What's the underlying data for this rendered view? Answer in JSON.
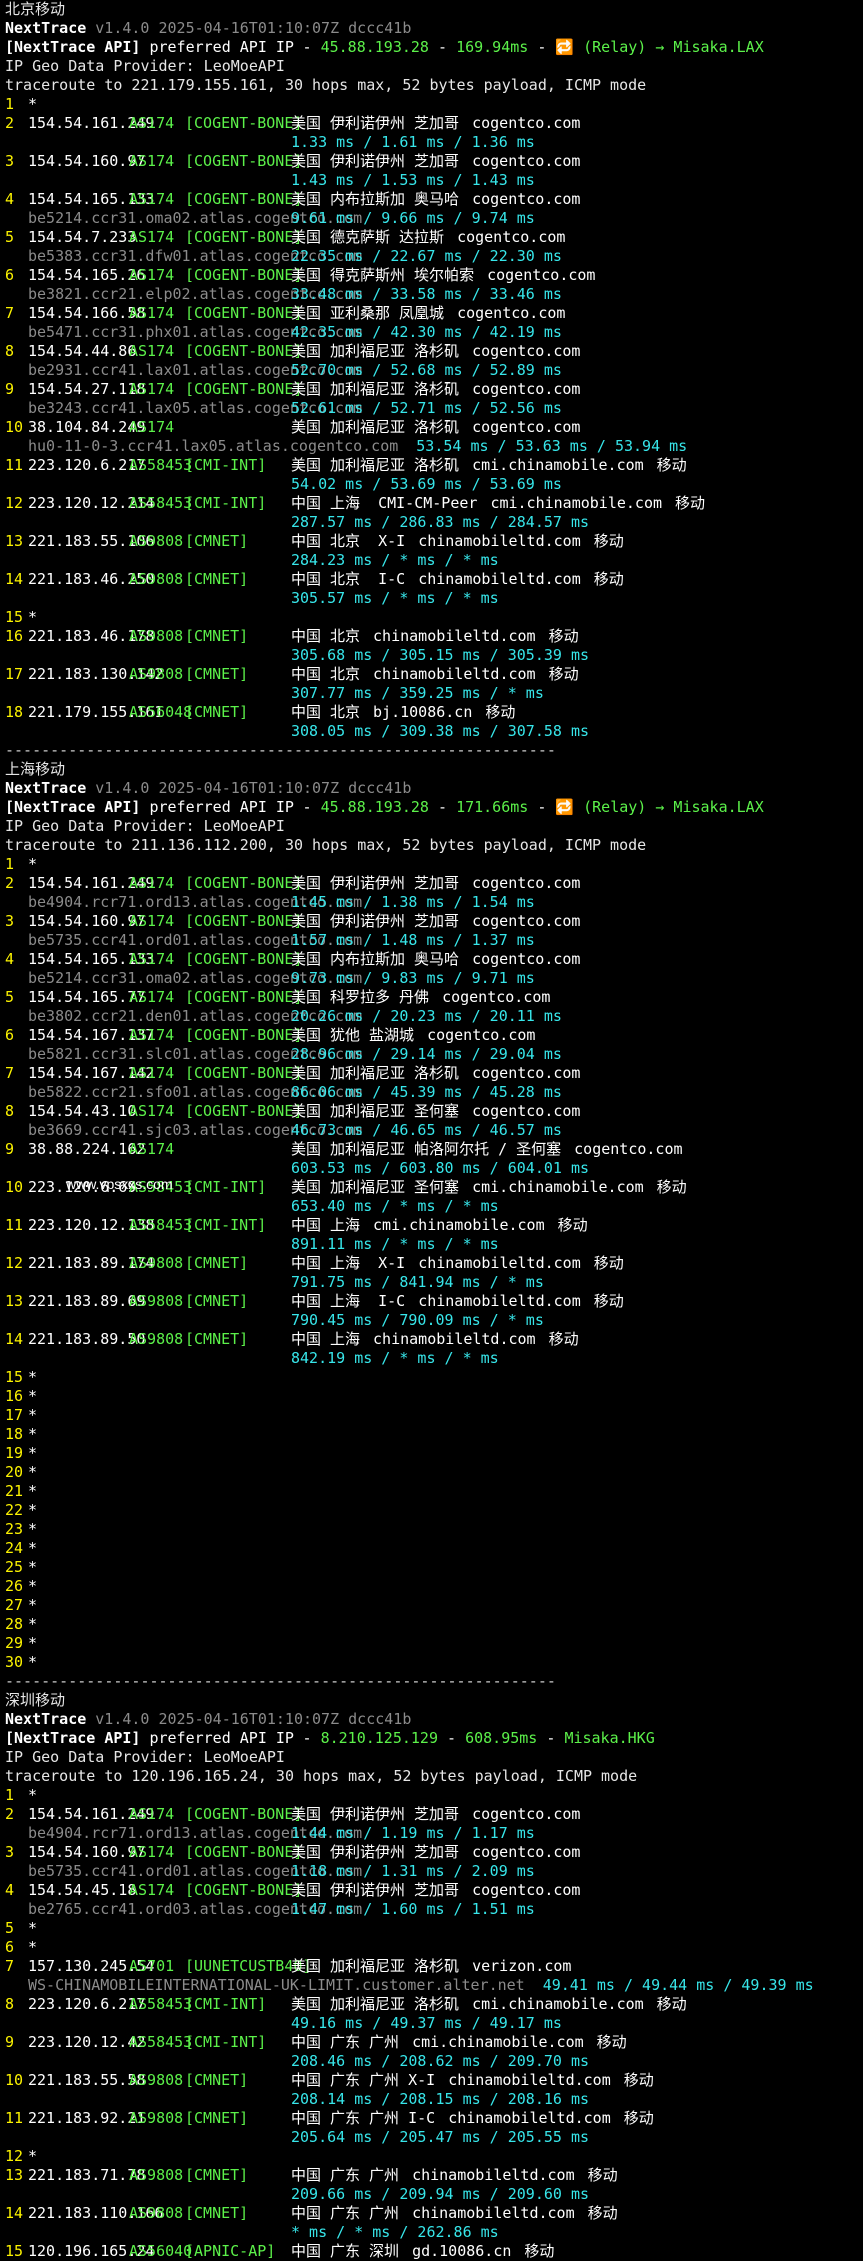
{
  "watermark": "www.vpsxxs.com",
  "separator": "-------------------------------------------------------------",
  "sections": [
    {
      "title": "北京移动",
      "nt_name": "NextTrace",
      "nt_version": "v1.4.0 2025-04-16T01:10:07Z dccc41b",
      "api_prefix": "[NextTrace API]",
      "api_text": "preferred API IP",
      "api_ip": "45.88.193.28",
      "api_ms": "169.94ms",
      "api_relay": "🔁 (Relay) → Misaka.LAX",
      "geo_provider": "IP Geo Data Provider: LeoMoeAPI",
      "traceroute": "traceroute to 221.179.155.161, 30 hops max, 52 bytes payload, ICMP mode",
      "hops": [
        {
          "n": "1",
          "star": true
        },
        {
          "n": "2",
          "ip": "154.54.161.249",
          "as": "AS174",
          "tag": "[COGENT-BONE]",
          "geo": "美国 伊利诺伊州 芝加哥",
          "dom": "cogentco.com",
          "isp": "",
          "host": "",
          "rtt": "1.33 ms / 1.61 ms / 1.36 ms"
        },
        {
          "n": "3",
          "ip": "154.54.160.97",
          "as": "AS174",
          "tag": "[COGENT-BONE]",
          "geo": "美国 伊利诺伊州 芝加哥",
          "dom": "cogentco.com",
          "isp": "",
          "host": "",
          "rtt": "1.43 ms / 1.53 ms / 1.43 ms"
        },
        {
          "n": "4",
          "ip": "154.54.165.133",
          "as": "AS174",
          "tag": "[COGENT-BONE]",
          "geo": "美国 内布拉斯加 奥马哈",
          "dom": "cogentco.com",
          "isp": "",
          "host": "be5214.ccr31.oma02.atlas.cogentco.com",
          "rtt": "9.61 ms / 9.66 ms / 9.74 ms"
        },
        {
          "n": "5",
          "ip": "154.54.7.233",
          "as": "AS174",
          "tag": "[COGENT-BONE]",
          "geo": "美国 德克萨斯 达拉斯",
          "dom": "cogentco.com",
          "isp": "",
          "host": "be5383.ccr31.dfw01.atlas.cogentco.com",
          "rtt": "22.35 ms / 22.67 ms / 22.30 ms"
        },
        {
          "n": "6",
          "ip": "154.54.165.26",
          "as": "AS174",
          "tag": "[COGENT-BONE]",
          "geo": "美国 得克萨斯州 埃尔帕索",
          "dom": "cogentco.com",
          "isp": "",
          "host": "be3821.ccr21.elp02.atlas.cogentco.com",
          "rtt": "33.48 ms / 33.58 ms / 33.46 ms"
        },
        {
          "n": "7",
          "ip": "154.54.166.58",
          "as": "AS174",
          "tag": "[COGENT-BONE]",
          "geo": "美国 亚利桑那 凤凰城",
          "dom": "cogentco.com",
          "isp": "",
          "host": "be5471.ccr31.phx01.atlas.cogentco.com",
          "rtt": "42.35 ms / 42.30 ms / 42.19 ms"
        },
        {
          "n": "8",
          "ip": "154.54.44.86",
          "as": "AS174",
          "tag": "[COGENT-BONE]",
          "geo": "美国 加利福尼亚 洛杉矶",
          "dom": "cogentco.com",
          "isp": "",
          "host": "be2931.ccr41.lax01.atlas.cogentco.com",
          "rtt": "52.70 ms / 52.68 ms / 52.89 ms"
        },
        {
          "n": "9",
          "ip": "154.54.27.118",
          "as": "AS174",
          "tag": "[COGENT-BONE]",
          "geo": "美国 加利福尼亚 洛杉矶",
          "dom": "cogentco.com",
          "isp": "",
          "host": "be3243.ccr41.lax05.atlas.cogentco.com",
          "rtt": "52.61 ms / 52.71 ms / 52.56 ms"
        },
        {
          "n": "10",
          "ip": "38.104.84.249",
          "as": "AS174",
          "tag": "",
          "geo": "美国 加利福尼亚 洛杉矶",
          "dom": "cogentco.com",
          "isp": "",
          "host": "hu0-11-0-3.ccr41.lax05.atlas.cogentco.com",
          "rtt": "53.54 ms / 53.63 ms / 53.94 ms",
          "rtt_inline": true
        },
        {
          "n": "11",
          "ip": "223.120.6.217",
          "as": "AS58453",
          "tag": "[CMI-INT]",
          "geo": "美国 加利福尼亚 洛杉矶",
          "dom": "cmi.chinamobile.com",
          "isp": "移动",
          "host": "",
          "rtt": "54.02 ms / 53.69 ms / 53.69 ms"
        },
        {
          "n": "12",
          "ip": "223.120.12.214",
          "as": "AS58453",
          "tag": "[CMI-INT]",
          "geo": "中国 上海  CMI-CM-Peer",
          "dom": "cmi.chinamobile.com",
          "isp": "移动",
          "host": "",
          "rtt": "287.57 ms / 286.83 ms / 284.57 ms"
        },
        {
          "n": "13",
          "ip": "221.183.55.106",
          "as": "AS9808",
          "tag": "[CMNET]",
          "geo": "中国 北京  X-I",
          "dom": "chinamobileltd.com",
          "isp": "移动",
          "host": "",
          "rtt": "284.23 ms / * ms / * ms"
        },
        {
          "n": "14",
          "ip": "221.183.46.250",
          "as": "AS9808",
          "tag": "[CMNET]",
          "geo": "中国 北京  I-C",
          "dom": "chinamobileltd.com",
          "isp": "移动",
          "host": "",
          "rtt": "305.57 ms / * ms / * ms"
        },
        {
          "n": "15",
          "star": true
        },
        {
          "n": "16",
          "ip": "221.183.46.178",
          "as": "AS9808",
          "tag": "[CMNET]",
          "geo": "中国 北京",
          "dom": "chinamobileltd.com",
          "isp": "移动",
          "host": "",
          "rtt": "305.68 ms / 305.15 ms / 305.39 ms"
        },
        {
          "n": "17",
          "ip": "221.183.130.142",
          "as": "AS9808",
          "tag": "[CMNET]",
          "geo": "中国 北京",
          "dom": "chinamobileltd.com",
          "isp": "移动",
          "host": "",
          "rtt": "307.77 ms / 359.25 ms / * ms"
        },
        {
          "n": "18",
          "ip": "221.179.155.161",
          "as": "AS56048",
          "tag": "[CMNET]",
          "geo": "中国 北京",
          "dom": "bj.10086.cn",
          "isp": "移动",
          "host": "",
          "rtt": "308.05 ms / 309.38 ms / 307.58 ms"
        }
      ]
    },
    {
      "title": "上海移动",
      "nt_name": "NextTrace",
      "nt_version": "v1.4.0 2025-04-16T01:10:07Z dccc41b",
      "api_prefix": "[NextTrace API]",
      "api_text": "preferred API IP",
      "api_ip": "45.88.193.28",
      "api_ms": "171.66ms",
      "api_relay": "🔁 (Relay) → Misaka.LAX",
      "geo_provider": "IP Geo Data Provider: LeoMoeAPI",
      "traceroute": "traceroute to 211.136.112.200, 30 hops max, 52 bytes payload, ICMP mode",
      "hops": [
        {
          "n": "1",
          "star": true
        },
        {
          "n": "2",
          "ip": "154.54.161.249",
          "as": "AS174",
          "tag": "[COGENT-BONE]",
          "geo": "美国 伊利诺伊州 芝加哥",
          "dom": "cogentco.com",
          "isp": "",
          "host": "be4904.rcr71.ord13.atlas.cogentco.com",
          "rtt": "1.45 ms / 1.38 ms / 1.54 ms"
        },
        {
          "n": "3",
          "ip": "154.54.160.97",
          "as": "AS174",
          "tag": "[COGENT-BONE]",
          "geo": "美国 伊利诺伊州 芝加哥",
          "dom": "cogentco.com",
          "isp": "",
          "host": "be5735.ccr41.ord01.atlas.cogentco.com",
          "rtt": "1.57 ms / 1.48 ms / 1.37 ms"
        },
        {
          "n": "4",
          "ip": "154.54.165.133",
          "as": "AS174",
          "tag": "[COGENT-BONE]",
          "geo": "美国 内布拉斯加 奥马哈",
          "dom": "cogentco.com",
          "isp": "",
          "host": "be5214.ccr31.oma02.atlas.cogentco.com",
          "rtt": "9.73 ms / 9.83 ms / 9.71 ms"
        },
        {
          "n": "5",
          "ip": "154.54.165.77",
          "as": "AS174",
          "tag": "[COGENT-BONE]",
          "geo": "美国 科罗拉多 丹佛",
          "dom": "cogentco.com",
          "isp": "",
          "host": "be3802.ccr21.den01.atlas.cogentco.com",
          "rtt": "20.26 ms / 20.23 ms / 20.11 ms"
        },
        {
          "n": "6",
          "ip": "154.54.167.137",
          "as": "AS174",
          "tag": "[COGENT-BONE]",
          "geo": "美国 犹他 盐湖城",
          "dom": "cogentco.com",
          "isp": "",
          "host": "be5821.ccr31.slc01.atlas.cogentco.com",
          "rtt": "28.96 ms / 29.14 ms / 29.04 ms"
        },
        {
          "n": "7",
          "ip": "154.54.167.142",
          "as": "AS174",
          "tag": "[COGENT-BONE]",
          "geo": "美国 加利福尼亚 洛杉矶",
          "dom": "cogentco.com",
          "isp": "",
          "host": "be5822.ccr21.sfo01.atlas.cogentco.com",
          "rtt": "86.06 ms / 45.39 ms / 45.28 ms"
        },
        {
          "n": "8",
          "ip": "154.54.43.10",
          "as": "AS174",
          "tag": "[COGENT-BONE]",
          "geo": "美国 加利福尼亚 圣何塞",
          "dom": "cogentco.com",
          "isp": "",
          "host": "be3669.ccr41.sjc03.atlas.cogentco.com",
          "rtt": "46.73 ms / 46.65 ms / 46.57 ms"
        },
        {
          "n": "9",
          "ip": "38.88.224.162",
          "as": "AS174",
          "tag": "",
          "geo": "美国 加利福尼亚 帕洛阿尔托 / 圣何塞",
          "dom": "cogentco.com",
          "isp": "",
          "host": "",
          "rtt": "603.53 ms / 603.80 ms / 604.01 ms"
        },
        {
          "n": "10",
          "ip": "223.120.6.69",
          "as": "AS58453",
          "tag": "[CMI-INT]",
          "geo": "美国 加利福尼亚 圣何塞",
          "dom": "cmi.chinamobile.com",
          "isp": "移动",
          "host": "",
          "rtt": "653.40 ms / * ms / * ms"
        },
        {
          "n": "11",
          "ip": "223.120.12.138",
          "as": "AS58453",
          "tag": "[CMI-INT]",
          "geo": "中国 上海",
          "dom": "cmi.chinamobile.com",
          "isp": "移动",
          "host": "",
          "rtt": "891.11 ms / * ms / * ms"
        },
        {
          "n": "12",
          "ip": "221.183.89.174",
          "as": "AS9808",
          "tag": "[CMNET]",
          "geo": "中国 上海  X-I",
          "dom": "chinamobileltd.com",
          "isp": "移动",
          "host": "",
          "rtt": "791.75 ms / 841.94 ms / * ms"
        },
        {
          "n": "13",
          "ip": "221.183.89.69",
          "as": "AS9808",
          "tag": "[CMNET]",
          "geo": "中国 上海  I-C",
          "dom": "chinamobileltd.com",
          "isp": "移动",
          "host": "",
          "rtt": "790.45 ms / 790.09 ms / * ms"
        },
        {
          "n": "14",
          "ip": "221.183.89.50",
          "as": "AS9808",
          "tag": "[CMNET]",
          "geo": "中国 上海",
          "dom": "chinamobileltd.com",
          "isp": "移动",
          "host": "",
          "rtt": "842.19 ms / * ms / * ms"
        },
        {
          "n": "15",
          "star": true
        },
        {
          "n": "16",
          "star": true
        },
        {
          "n": "17",
          "star": true
        },
        {
          "n": "18",
          "star": true
        },
        {
          "n": "19",
          "star": true
        },
        {
          "n": "20",
          "star": true
        },
        {
          "n": "21",
          "star": true
        },
        {
          "n": "22",
          "star": true
        },
        {
          "n": "23",
          "star": true
        },
        {
          "n": "24",
          "star": true
        },
        {
          "n": "25",
          "star": true
        },
        {
          "n": "26",
          "star": true
        },
        {
          "n": "27",
          "star": true
        },
        {
          "n": "28",
          "star": true
        },
        {
          "n": "29",
          "star": true
        },
        {
          "n": "30",
          "star": true
        }
      ]
    },
    {
      "title": "深圳移动",
      "nt_name": "NextTrace",
      "nt_version": "v1.4.0 2025-04-16T01:10:07Z dccc41b",
      "api_prefix": "[NextTrace API]",
      "api_text": "preferred API IP",
      "api_ip": "8.210.125.129",
      "api_ms": "608.95ms",
      "api_relay": "Misaka.HKG",
      "geo_provider": "IP Geo Data Provider: LeoMoeAPI",
      "traceroute": "traceroute to 120.196.165.24, 30 hops max, 52 bytes payload, ICMP mode",
      "hops": [
        {
          "n": "1",
          "star": true
        },
        {
          "n": "2",
          "ip": "154.54.161.249",
          "as": "AS174",
          "tag": "[COGENT-BONE]",
          "geo": "美国 伊利诺伊州 芝加哥",
          "dom": "cogentco.com",
          "isp": "",
          "host": "be4904.rcr71.ord13.atlas.cogentco.com",
          "rtt": "1.44 ms / 1.19 ms / 1.17 ms"
        },
        {
          "n": "3",
          "ip": "154.54.160.97",
          "as": "AS174",
          "tag": "[COGENT-BONE]",
          "geo": "美国 伊利诺伊州 芝加哥",
          "dom": "cogentco.com",
          "isp": "",
          "host": "be5735.ccr41.ord01.atlas.cogentco.com",
          "rtt": "1.18 ms / 1.31 ms / 2.09 ms"
        },
        {
          "n": "4",
          "ip": "154.54.45.18",
          "as": "AS174",
          "tag": "[COGENT-BONE]",
          "geo": "美国 伊利诺伊州 芝加哥",
          "dom": "cogentco.com",
          "isp": "",
          "host": "be2765.ccr41.ord03.atlas.cogentco.com",
          "rtt": "1.47 ms / 1.60 ms / 1.51 ms"
        },
        {
          "n": "5",
          "star": true
        },
        {
          "n": "6",
          "star": true
        },
        {
          "n": "7",
          "ip": "157.130.245.54",
          "as": "AS701",
          "tag": "[UUNETCUSTB40]",
          "geo": "美国 加利福尼亚 洛杉矶",
          "dom": "verizon.com",
          "isp": "",
          "host": "WS-CHINAMOBILEINTERNATIONAL-UK-LIMIT.customer.alter.net",
          "rtt": "49.41 ms / 49.44 ms / 49.39 ms",
          "rtt_inline": true
        },
        {
          "n": "8",
          "ip": "223.120.6.217",
          "as": "AS58453",
          "tag": "[CMI-INT]",
          "geo": "美国 加利福尼亚 洛杉矶",
          "dom": "cmi.chinamobile.com",
          "isp": "移动",
          "host": "",
          "rtt": "49.16 ms / 49.37 ms / 49.17 ms"
        },
        {
          "n": "9",
          "ip": "223.120.12.42",
          "as": "AS58453",
          "tag": "[CMI-INT]",
          "geo": "中国 广东 广州",
          "dom": "cmi.chinamobile.com",
          "isp": "移动",
          "host": "",
          "rtt": "208.46 ms / 208.62 ms / 209.70 ms"
        },
        {
          "n": "10",
          "ip": "221.183.55.58",
          "as": "AS9808",
          "tag": "[CMNET]",
          "geo": "中国 广东 广州 X-I",
          "dom": "chinamobileltd.com",
          "isp": "移动",
          "host": "",
          "rtt": "208.14 ms / 208.15 ms / 208.16 ms"
        },
        {
          "n": "11",
          "ip": "221.183.92.21",
          "as": "AS9808",
          "tag": "[CMNET]",
          "geo": "中国 广东 广州 I-C",
          "dom": "chinamobileltd.com",
          "isp": "移动",
          "host": "",
          "rtt": "205.64 ms / 205.47 ms / 205.55 ms"
        },
        {
          "n": "12",
          "star": true
        },
        {
          "n": "13",
          "ip": "221.183.71.78",
          "as": "AS9808",
          "tag": "[CMNET]",
          "geo": "中国 广东 广州",
          "dom": "chinamobileltd.com",
          "isp": "移动",
          "host": "",
          "rtt": "209.66 ms / 209.94 ms / 209.60 ms"
        },
        {
          "n": "14",
          "ip": "221.183.110.166",
          "as": "AS9808",
          "tag": "[CMNET]",
          "geo": "中国 广东 广州",
          "dom": "chinamobileltd.com",
          "isp": "移动",
          "host": "",
          "rtt": "* ms / * ms / 262.86 ms"
        },
        {
          "n": "15",
          "ip": "120.196.165.24",
          "as": "AS56040",
          "tag": "[APNIC-AP]",
          "geo": "中国 广东 深圳",
          "dom": "gd.10086.cn",
          "isp": "移动",
          "host": "",
          "rtt": ""
        }
      ]
    }
  ]
}
